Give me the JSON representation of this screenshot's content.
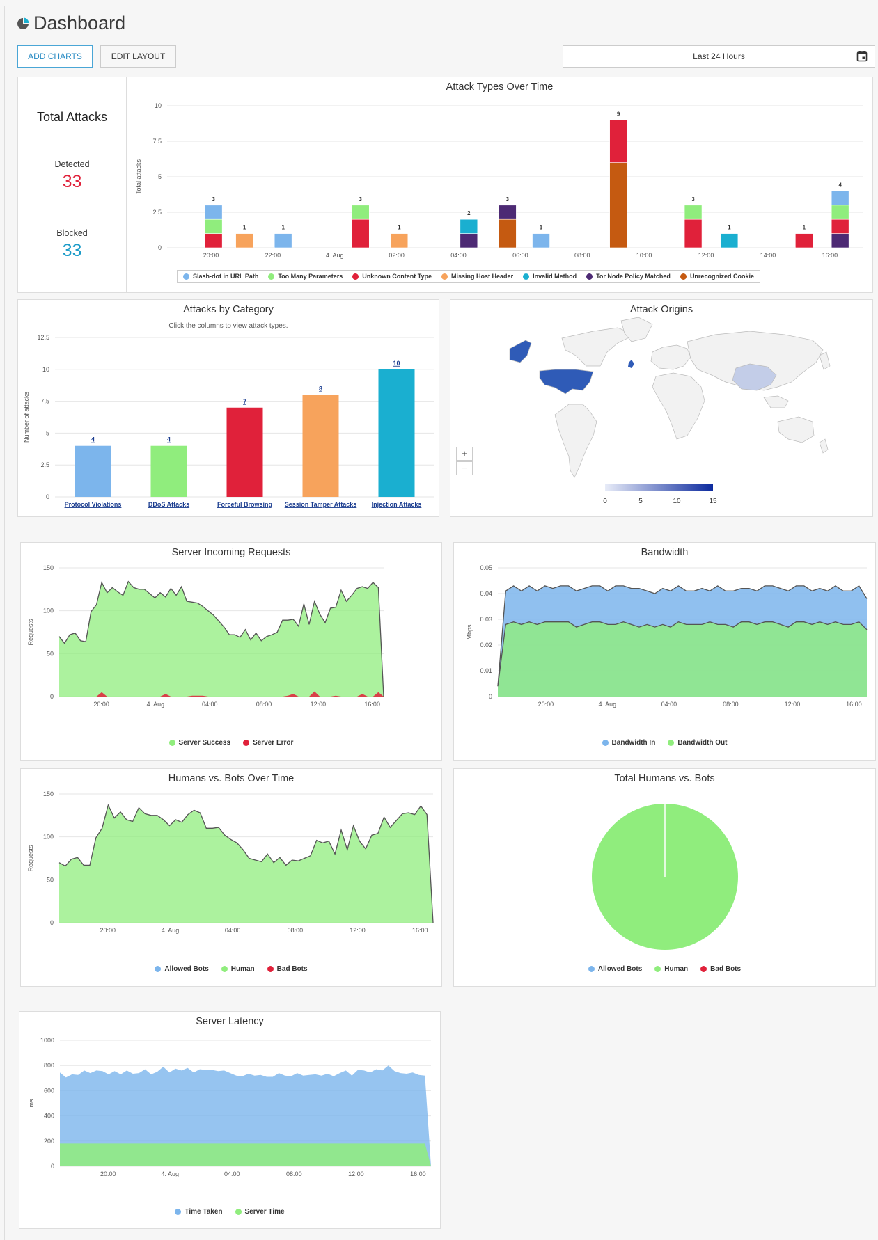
{
  "header": {
    "title": "Dashboard",
    "add_charts": "ADD CHARTS",
    "edit_layout": "EDIT LAYOUT",
    "range": "Last 24 Hours"
  },
  "totals": {
    "title": "Total Attacks",
    "detected_label": "Detected",
    "detected_value": "33",
    "blocked_label": "Blocked",
    "blocked_value": "33",
    "detected_color": "#e0213a",
    "blocked_color": "#1a9bc8"
  },
  "colors": {
    "slash": "#7cb5ec",
    "params": "#90ed7d",
    "content": "#e0213a",
    "host": "#f7a35c",
    "method": "#1aafd0",
    "tor": "#4d2a74",
    "cookie": "#c55a11",
    "map": "#2f5bb7"
  },
  "charts": {
    "attack_types": {
      "type": "bar",
      "stacked": true,
      "title": "Attack Types Over Time",
      "ylabel": "Total attacks",
      "ylim": [
        0,
        10
      ],
      "yticks": [
        "10",
        "7.5",
        "5",
        "2.5",
        "0"
      ],
      "xticks": [
        "20:00",
        "22:00",
        "4. Aug",
        "02:00",
        "04:00",
        "06:00",
        "08:00",
        "10:00",
        "12:00",
        "14:00",
        "16:00"
      ],
      "series": [
        {
          "name": "Slash-dot in URL Path",
          "color": "#7cb5ec"
        },
        {
          "name": "Too Many Parameters",
          "color": "#90ed7d"
        },
        {
          "name": "Unknown Content Type",
          "color": "#e0213a"
        },
        {
          "name": "Missing Host Header",
          "color": "#f7a35c"
        },
        {
          "name": "Invalid Method",
          "color": "#1aafd0"
        },
        {
          "name": "Tor Node Policy Matched",
          "color": "#4d2a74"
        },
        {
          "name": "Unrecognized Cookie",
          "color": "#c55a11"
        }
      ],
      "bars": [
        {
          "x": "19:30",
          "total": "3",
          "stack": [
            [
              "Unknown Content Type",
              1
            ],
            [
              "Too Many Parameters",
              1
            ],
            [
              "Slash-dot in URL Path",
              1
            ]
          ]
        },
        {
          "x": "20:30",
          "total": "1",
          "stack": [
            [
              "Missing Host Header",
              1
            ]
          ]
        },
        {
          "x": "21:45",
          "total": "1",
          "stack": [
            [
              "Slash-dot in URL Path",
              1
            ]
          ]
        },
        {
          "x": "00:15",
          "total": "3",
          "stack": [
            [
              "Unknown Content Type",
              2
            ],
            [
              "Too Many Parameters",
              1
            ]
          ]
        },
        {
          "x": "01:30",
          "total": "1",
          "stack": [
            [
              "Missing Host Header",
              1
            ]
          ]
        },
        {
          "x": "03:45",
          "total": "2",
          "stack": [
            [
              "Tor Node Policy Matched",
              1
            ],
            [
              "Invalid Method",
              1
            ]
          ]
        },
        {
          "x": "05:00",
          "total": "3",
          "stack": [
            [
              "Unrecognized Cookie",
              2
            ],
            [
              "Tor Node Policy Matched",
              1
            ]
          ]
        },
        {
          "x": "06:05",
          "total": "1",
          "stack": [
            [
              "Slash-dot in URL Path",
              1
            ]
          ]
        },
        {
          "x": "08:35",
          "total": "9",
          "stack": [
            [
              "Unrecognized Cookie",
              6
            ],
            [
              "Unknown Content Type",
              3
            ]
          ]
        },
        {
          "x": "11:00",
          "total": "3",
          "stack": [
            [
              "Unknown Content Type",
              2
            ],
            [
              "Too Many Parameters",
              1
            ]
          ]
        },
        {
          "x": "12:10",
          "total": "1",
          "stack": [
            [
              "Invalid Method",
              1
            ]
          ]
        },
        {
          "x": "14:35",
          "total": "1",
          "stack": [
            [
              "Unknown Content Type",
              1
            ]
          ]
        },
        {
          "x": "15:45",
          "total": "4",
          "stack": [
            [
              "Tor Node Policy Matched",
              1
            ],
            [
              "Unknown Content Type",
              1
            ],
            [
              "Too Many Parameters",
              1
            ],
            [
              "Slash-dot in URL Path",
              1
            ]
          ]
        }
      ]
    },
    "category": {
      "type": "bar",
      "title": "Attacks by Category",
      "subtitle": "Click the columns to view attack types.",
      "ylabel": "Number of attacks",
      "ylim": [
        0,
        12.5
      ],
      "yticks": [
        "12.5",
        "10",
        "7.5",
        "5",
        "2.5",
        "0"
      ],
      "categories": [
        "Protocol Violations",
        "DDoS Attacks",
        "Forceful Browsing",
        "Session Tamper Attacks",
        "Injection Attacks"
      ],
      "values": [
        4,
        4,
        7,
        8,
        10
      ],
      "value_labels": [
        "4",
        "4",
        "7",
        "8",
        "10"
      ],
      "colors": [
        "#7cb5ec",
        "#90ed7d",
        "#e0213a",
        "#f7a35c",
        "#1aafd0"
      ]
    },
    "origins": {
      "title": "Attack Origins",
      "scale": [
        "0",
        "5",
        "10",
        "15"
      ],
      "zoom_in": "+",
      "zoom_out": "−"
    },
    "requests": {
      "type": "area",
      "title": "Server Incoming Requests",
      "ylabel": "Requests",
      "ylim": [
        0,
        150
      ],
      "yticks": [
        "150",
        "100",
        "50",
        "0"
      ],
      "xticks": [
        "20:00",
        "4. Aug",
        "04:00",
        "08:00",
        "12:00",
        "16:00"
      ],
      "series": [
        {
          "name": "Server Success",
          "color": "#90ed7d",
          "values": [
            70,
            62,
            72,
            74,
            65,
            64,
            99,
            107,
            133,
            121,
            127,
            122,
            118,
            134,
            127,
            125,
            125,
            120,
            115,
            121,
            116,
            126,
            118,
            128,
            111,
            110,
            109,
            105,
            100,
            95,
            88,
            81,
            72,
            72,
            69,
            78,
            66,
            74,
            65,
            70,
            72,
            75,
            89,
            89,
            90,
            82,
            108,
            84,
            111,
            96,
            86,
            103,
            104,
            124,
            111,
            118,
            126,
            128,
            126,
            133,
            127,
            0
          ]
        },
        {
          "name": "Server Error",
          "color": "#e0213a",
          "values": [
            0,
            0,
            0,
            0,
            0,
            0,
            0,
            0,
            5,
            0,
            0,
            0,
            0,
            0,
            0,
            0,
            0,
            0,
            0,
            0,
            3,
            0,
            0,
            0,
            0,
            1,
            1,
            1,
            0,
            0,
            0,
            0,
            0,
            0,
            0,
            0,
            0,
            0,
            0,
            0,
            0,
            0,
            0,
            1,
            3,
            0,
            0,
            0,
            6,
            0,
            0,
            0,
            1,
            0,
            0,
            0,
            0,
            3,
            0,
            0,
            5,
            0
          ]
        }
      ]
    },
    "bandwidth": {
      "type": "area",
      "title": "Bandwidth",
      "ylabel": "Mbps",
      "ylim": [
        0,
        0.05
      ],
      "yticks": [
        "0.05",
        "0.04",
        "0.03",
        "0.02",
        "0.01",
        "0"
      ],
      "xticks": [
        "20:00",
        "4. Aug",
        "04:00",
        "08:00",
        "12:00",
        "16:00"
      ],
      "series": [
        {
          "name": "Bandwidth In",
          "color": "#7cb5ec",
          "values": [
            0.004,
            0.041,
            0.043,
            0.041,
            0.043,
            0.041,
            0.043,
            0.042,
            0.043,
            0.043,
            0.041,
            0.042,
            0.043,
            0.043,
            0.041,
            0.043,
            0.043,
            0.042,
            0.042,
            0.041,
            0.04,
            0.042,
            0.041,
            0.043,
            0.041,
            0.041,
            0.042,
            0.041,
            0.043,
            0.041,
            0.041,
            0.042,
            0.042,
            0.041,
            0.043,
            0.043,
            0.042,
            0.041,
            0.043,
            0.043,
            0.041,
            0.042,
            0.041,
            0.043,
            0.041,
            0.041,
            0.043,
            0.038
          ]
        },
        {
          "name": "Bandwidth Out",
          "color": "#90ed7d",
          "values": [
            0.004,
            0.028,
            0.029,
            0.028,
            0.029,
            0.028,
            0.029,
            0.029,
            0.029,
            0.029,
            0.027,
            0.028,
            0.029,
            0.029,
            0.028,
            0.028,
            0.029,
            0.028,
            0.027,
            0.028,
            0.027,
            0.028,
            0.027,
            0.029,
            0.028,
            0.028,
            0.028,
            0.029,
            0.028,
            0.028,
            0.027,
            0.029,
            0.029,
            0.028,
            0.029,
            0.029,
            0.028,
            0.027,
            0.029,
            0.029,
            0.028,
            0.029,
            0.028,
            0.029,
            0.028,
            0.028,
            0.029,
            0.026
          ]
        }
      ]
    },
    "humans_bots": {
      "type": "area",
      "title": "Humans vs. Bots Over Time",
      "ylabel": "Requests",
      "ylim": [
        0,
        150
      ],
      "yticks": [
        "150",
        "100",
        "50",
        "0"
      ],
      "xticks": [
        "20:00",
        "4. Aug",
        "04:00",
        "08:00",
        "12:00",
        "16:00"
      ],
      "series": [
        {
          "name": "Allowed Bots",
          "color": "#7cb5ec",
          "values": [
            0,
            0,
            0,
            0,
            0,
            0,
            0,
            0,
            0,
            0,
            0,
            0,
            0,
            0,
            0,
            0,
            0,
            0,
            0,
            0,
            0,
            0,
            0,
            0,
            0,
            0,
            0,
            0,
            0,
            0,
            0,
            0,
            0,
            0,
            0,
            0,
            0,
            0,
            0,
            0,
            0,
            0,
            0,
            0,
            0,
            0,
            0,
            0,
            0,
            0,
            0,
            0,
            0,
            0,
            0,
            0,
            0,
            0,
            0,
            0,
            0,
            0
          ]
        },
        {
          "name": "Human",
          "color": "#90ed7d",
          "values": [
            70,
            66,
            74,
            76,
            67,
            67,
            99,
            110,
            137,
            122,
            129,
            120,
            118,
            134,
            127,
            125,
            125,
            120,
            113,
            120,
            117,
            126,
            131,
            128,
            110,
            110,
            111,
            102,
            97,
            93,
            85,
            75,
            73,
            71,
            80,
            70,
            76,
            67,
            73,
            72,
            75,
            78,
            96,
            93,
            95,
            80,
            108,
            85,
            113,
            95,
            86,
            102,
            104,
            123,
            111,
            119,
            127,
            128,
            126,
            136,
            126,
            0
          ]
        },
        {
          "name": "Bad Bots",
          "color": "#e0213a",
          "values": [
            0,
            0,
            0,
            0,
            0,
            0,
            0,
            0,
            0,
            0,
            0,
            0,
            0,
            0,
            0,
            0,
            0,
            0,
            0,
            0,
            0,
            0,
            0,
            0,
            0,
            0,
            0,
            0,
            0,
            0,
            0,
            0,
            0,
            0,
            0,
            0,
            0,
            0,
            0,
            0,
            0,
            0,
            0,
            0,
            0,
            0,
            0,
            0,
            0,
            0,
            0,
            0,
            0,
            0,
            0,
            0,
            0,
            0,
            0,
            0,
            0,
            0
          ]
        }
      ]
    },
    "total_humans_bots": {
      "type": "pie",
      "title": "Total Humans vs. Bots",
      "slices": [
        {
          "name": "Allowed Bots",
          "color": "#7cb5ec",
          "value": 0
        },
        {
          "name": "Human",
          "color": "#90ed7d",
          "value": 100
        },
        {
          "name": "Bad Bots",
          "color": "#e0213a",
          "value": 0
        }
      ]
    },
    "latency": {
      "type": "area",
      "title": "Server Latency",
      "ylabel": "ms",
      "ylim": [
        0,
        1000
      ],
      "yticks": [
        "1000",
        "800",
        "600",
        "400",
        "200",
        "0"
      ],
      "xticks": [
        "20:00",
        "4. Aug",
        "04:00",
        "08:00",
        "12:00",
        "16:00"
      ],
      "series": [
        {
          "name": "Time Taken",
          "color": "#7cb5ec",
          "values": [
            745,
            705,
            730,
            725,
            760,
            740,
            760,
            755,
            730,
            755,
            730,
            760,
            735,
            740,
            770,
            730,
            750,
            790,
            745,
            775,
            760,
            780,
            745,
            770,
            765,
            765,
            755,
            760,
            740,
            720,
            715,
            735,
            720,
            725,
            710,
            710,
            740,
            720,
            715,
            740,
            720,
            725,
            730,
            720,
            735,
            715,
            740,
            760,
            720,
            765,
            760,
            745,
            770,
            760,
            800,
            755,
            740,
            735,
            745,
            725,
            720,
            0
          ]
        },
        {
          "name": "Server Time",
          "color": "#90ed7d",
          "values": [
            180,
            180,
            180,
            180,
            180,
            180,
            180,
            180,
            180,
            180,
            180,
            180,
            180,
            180,
            180,
            180,
            180,
            180,
            180,
            180,
            180,
            180,
            180,
            180,
            180,
            180,
            180,
            180,
            180,
            180,
            180,
            180,
            180,
            180,
            180,
            180,
            180,
            180,
            180,
            180,
            180,
            180,
            180,
            180,
            180,
            180,
            180,
            180,
            180,
            180,
            180,
            180,
            180,
            180,
            180,
            180,
            180,
            180,
            180,
            180,
            180,
            0
          ]
        }
      ]
    }
  }
}
